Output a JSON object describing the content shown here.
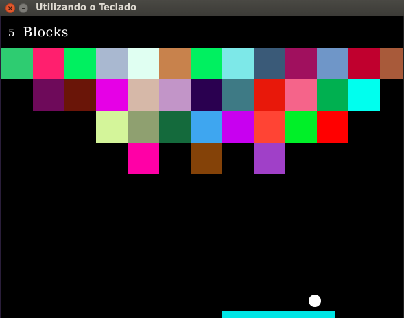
{
  "window": {
    "title": "Utilizando o Teclado",
    "close_glyph": "×",
    "minimize_glyph": "–"
  },
  "hud": {
    "count": "5",
    "label": "Blocks"
  },
  "blocks": {
    "row1": [
      "#2ecc71",
      "#ff1f6e",
      "#00f060",
      "#a9b8d0",
      "#e0fff2",
      "#c8824c",
      "#00f060",
      "#7de8e8",
      "#3a5a78",
      "#a0105e",
      "#6f96c8",
      "#c0002e",
      "#a85a3a"
    ],
    "row2": [
      "#000000",
      "#6e0a5a",
      "#6a1508",
      "#e600e6",
      "#d6b8a8",
      "#c295c8",
      "#2a0050",
      "#3e7a85",
      "#e8180a",
      "#f5648a",
      "#00b050",
      "#00ffee",
      "#000000"
    ],
    "row3": [
      "#000000",
      "#000000",
      "#000000",
      "#d4f59a",
      "#8fa070",
      "#146a3c",
      "#3ea6f0",
      "#c800f0",
      "#ff4434",
      "#00f028",
      "#ff0000",
      "#000000",
      "#000000"
    ],
    "row4": [
      "#000000",
      "#000000",
      "#000000",
      "#000000",
      "#ff00a6",
      "#000000",
      "#844208",
      "#000000",
      "#a040c8",
      "#000000",
      "#000000",
      "#000000",
      "#000000"
    ]
  },
  "colors": {
    "background": "#000000",
    "ball": "#ffffff",
    "paddle": "#00e5e5"
  }
}
